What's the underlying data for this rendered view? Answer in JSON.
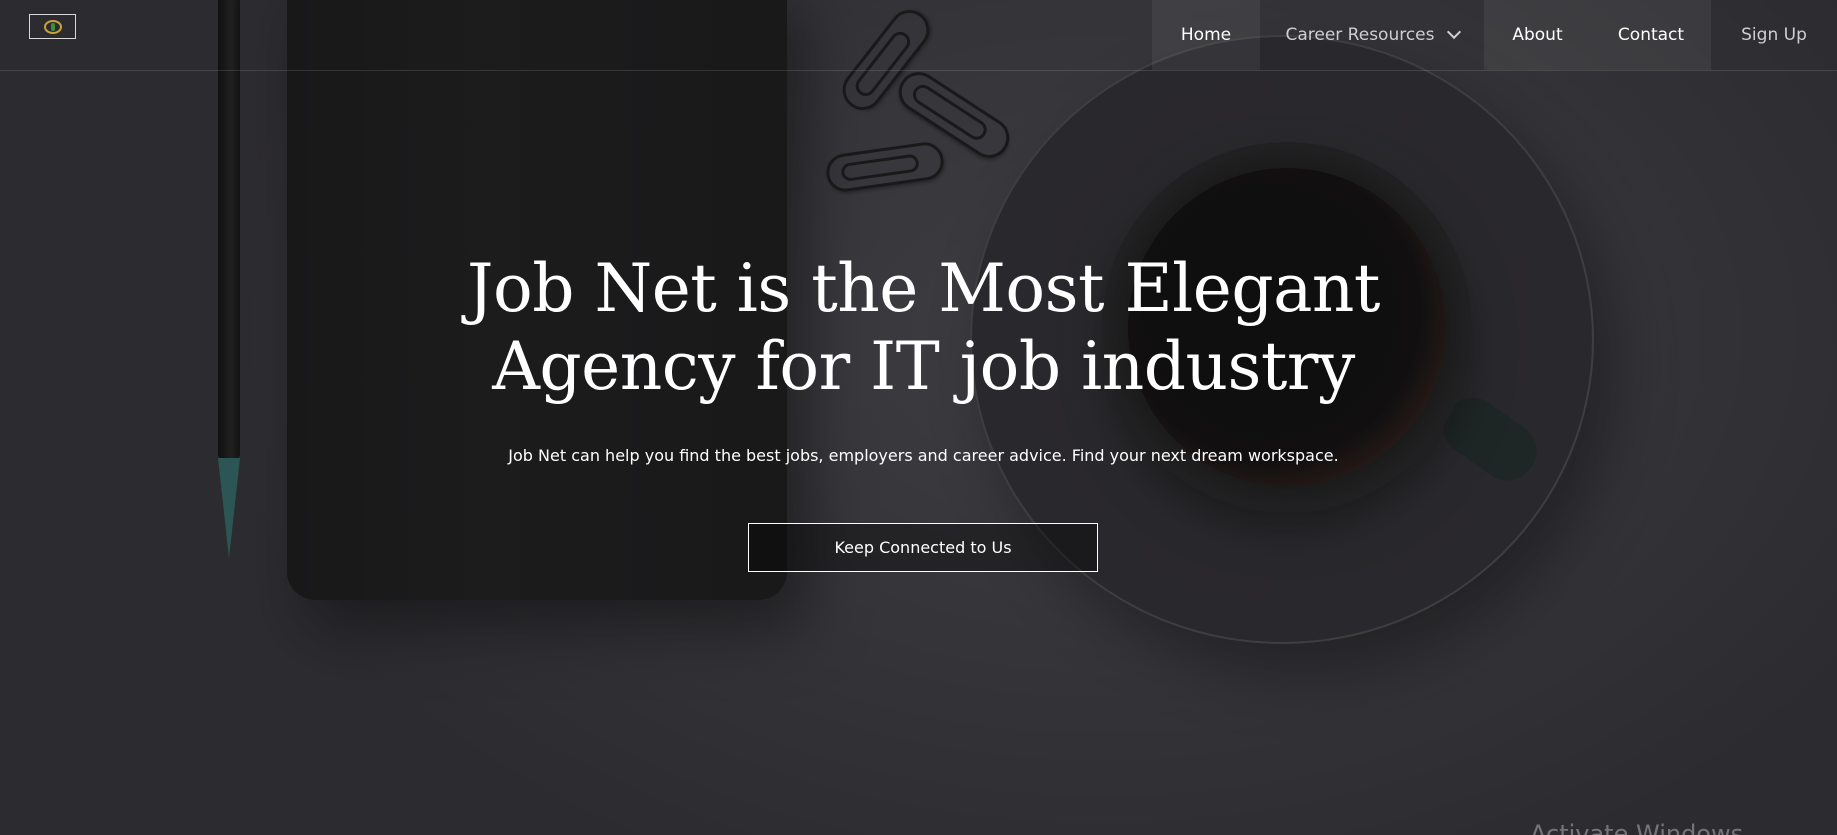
{
  "nav": {
    "logo": "logo-icon",
    "items": [
      {
        "label": "Home"
      },
      {
        "label": "Career Resources"
      },
      {
        "label": "About"
      },
      {
        "label": "Contact"
      },
      {
        "label": "Sign Up"
      }
    ]
  },
  "hero": {
    "title_line1": "Job Net is the Most Elegant",
    "title_line2": "Agency for IT job industry",
    "subtitle": "Job Net can help you find the best jobs, employers and career advice. Find your next dream workspace.",
    "cta_label": "Keep Connected to Us"
  },
  "watermark": "Activate Windows",
  "colors": {
    "background": "#3d3c41",
    "text": "#ffffff",
    "logo_accent": "#c8a23a"
  }
}
